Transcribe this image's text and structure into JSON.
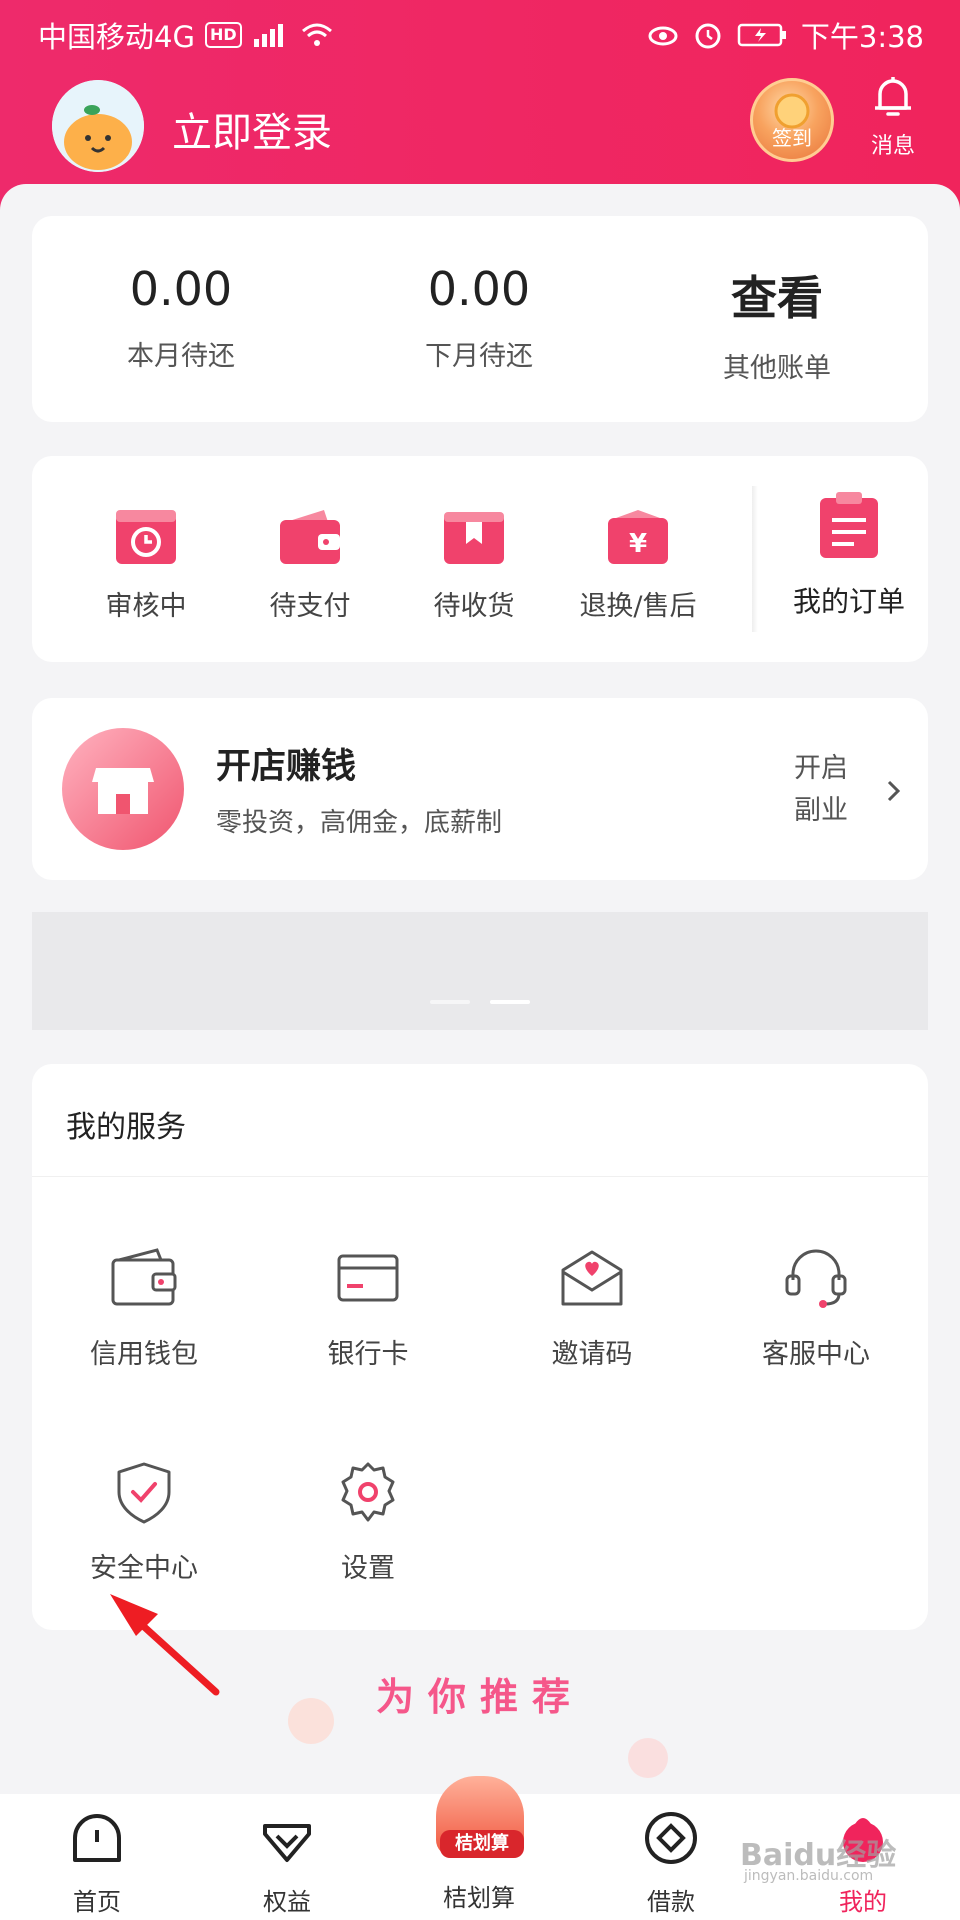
{
  "status_bar": {
    "carrier": "中国移动4G",
    "hd_badge": "HD",
    "time": "下午3:38"
  },
  "header": {
    "login_text": "立即登录",
    "signin_label": "签到",
    "message_label": "消息"
  },
  "bills": [
    {
      "value": "0.00",
      "label": "本月待还"
    },
    {
      "value": "0.00",
      "label": "下月待还"
    },
    {
      "value": "查看",
      "label": "其他账单"
    }
  ],
  "orders": {
    "items": [
      {
        "label": "审核中",
        "icon": "clock-icon"
      },
      {
        "label": "待支付",
        "icon": "wallet-icon"
      },
      {
        "label": "待收货",
        "icon": "box-icon"
      },
      {
        "label": "退换/售后",
        "icon": "yuan-return-icon"
      }
    ],
    "mine_label": "我的订单"
  },
  "shop": {
    "title": "开店赚钱",
    "subtitle": "零投资，高佣金，底薪制",
    "side_line1": "开启",
    "side_line2": "副业"
  },
  "services": {
    "title": "我的服务",
    "items": [
      {
        "label": "信用钱包",
        "icon": "wallet-icon"
      },
      {
        "label": "银行卡",
        "icon": "bank-card-icon"
      },
      {
        "label": "邀请码",
        "icon": "envelope-heart-icon"
      },
      {
        "label": "客服中心",
        "icon": "headset-icon"
      },
      {
        "label": "安全中心",
        "icon": "shield-check-icon"
      },
      {
        "label": "设置",
        "icon": "gear-icon"
      }
    ]
  },
  "recommend_title": "为你推荐",
  "tabbar": {
    "items": [
      {
        "label": "首页"
      },
      {
        "label": "权益"
      },
      {
        "label": "桔划算",
        "tag": "桔划算"
      },
      {
        "label": "借款"
      },
      {
        "label": "我的"
      }
    ]
  },
  "watermark": {
    "text": "Baidu经验",
    "sub": "jingyan.baidu.com"
  },
  "colors": {
    "brand": "#f0245c",
    "accent_pink": "#f5578a"
  }
}
